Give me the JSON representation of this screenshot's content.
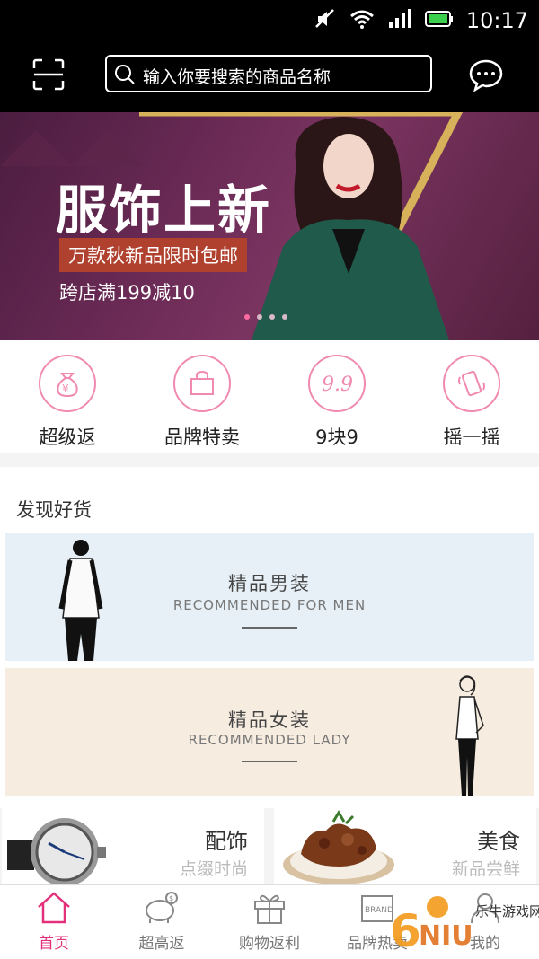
{
  "statusbar": {
    "time": "10:17"
  },
  "search": {
    "placeholder": "输入你要搜索的商品名称"
  },
  "banner": {
    "title": "服饰上新",
    "tag": "万款秋新品限时包邮",
    "subtitle": "跨店满199减10",
    "dot_count": 4,
    "active_dot": 1
  },
  "quick_links": [
    {
      "label": "超级返",
      "icon": "money-bag-icon"
    },
    {
      "label": "品牌特卖",
      "icon": "shopping-bag-icon"
    },
    {
      "label": "9块9",
      "icon": "99-icon"
    },
    {
      "label": "摇一摇",
      "icon": "shake-phone-icon"
    }
  ],
  "discover": {
    "heading": "发现好货",
    "men": {
      "title": "精品男装",
      "subtitle": "RECOMMENDED FOR MEN"
    },
    "lady": {
      "title": "精品女装",
      "subtitle": "RECOMMENDED LADY"
    }
  },
  "tiles": [
    {
      "name": "配饰",
      "desc": "点缀时尚"
    },
    {
      "name": "美食",
      "desc": "新品尝鲜"
    }
  ],
  "tabs": [
    {
      "label": "首页",
      "icon": "home-icon",
      "active": true
    },
    {
      "label": "超高返",
      "icon": "piggy-bank-icon",
      "active": false
    },
    {
      "label": "购物返利",
      "icon": "gift-icon",
      "active": false
    },
    {
      "label": "品牌热卖",
      "icon": "brand-icon",
      "active": false
    },
    {
      "label": "我的",
      "icon": "user-icon",
      "active": false
    }
  ],
  "watermark": {
    "text": "乐牛游戏网",
    "logo_text": "6NIU.com"
  },
  "colors": {
    "accent": "#e3307a",
    "icon_pink": "#f08ab0"
  }
}
